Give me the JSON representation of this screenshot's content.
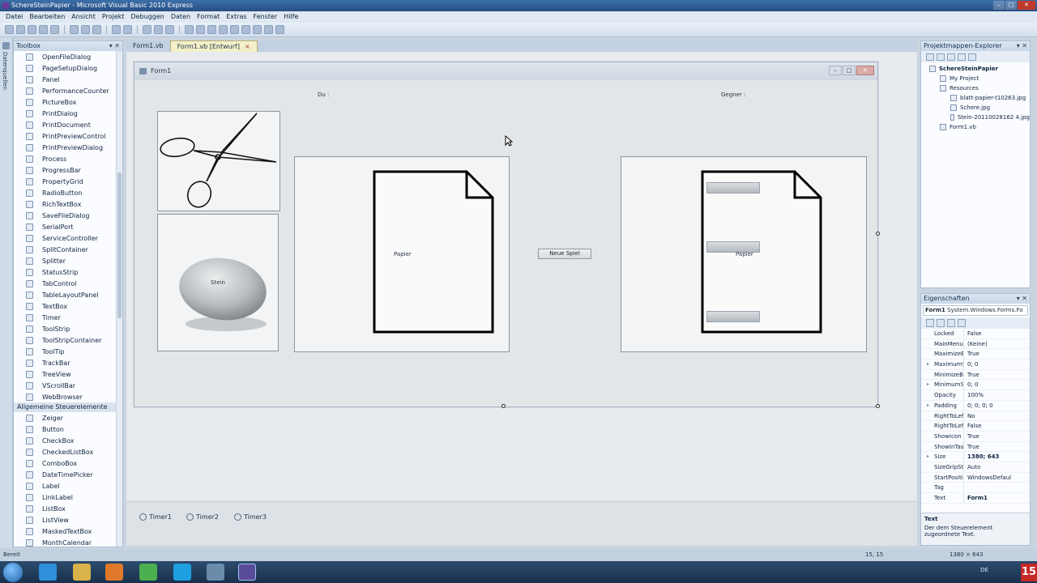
{
  "window": {
    "title": "SchereSteinPapier - Microsoft Visual Basic 2010 Express"
  },
  "menu": [
    "Datei",
    "Bearbeiten",
    "Ansicht",
    "Projekt",
    "Debuggen",
    "Daten",
    "Format",
    "Extras",
    "Fenster",
    "Hilfe"
  ],
  "left_strip": {
    "label": "Datenquellen"
  },
  "toolbox": {
    "title": "Toolbox",
    "items": [
      "OpenFileDialog",
      "PageSetupDialog",
      "Panel",
      "PerformanceCounter",
      "PictureBox",
      "PrintDialog",
      "PrintDocument",
      "PrintPreviewControl",
      "PrintPreviewDialog",
      "Process",
      "ProgressBar",
      "PropertyGrid",
      "RadioButton",
      "RichTextBox",
      "SaveFileDialog",
      "SerialPort",
      "ServiceController",
      "SplitContainer",
      "Splitter",
      "StatusStrip",
      "TabControl",
      "TableLayoutPanel",
      "TextBox",
      "Timer",
      "ToolStrip",
      "ToolStripContainer",
      "ToolTip",
      "TrackBar",
      "TreeView",
      "VScrollBar",
      "WebBrowser"
    ],
    "group_label": "Allgemeine Steuerelemente",
    "group_items": [
      "Zeiger",
      "Button",
      "CheckBox",
      "CheckedListBox",
      "ComboBox",
      "DateTimePicker",
      "Label",
      "LinkLabel",
      "ListBox",
      "ListView",
      "MaskedTextBox",
      "MonthCalendar"
    ]
  },
  "doc_tabs": [
    {
      "label": "Form1.vb",
      "active": false
    },
    {
      "label": "Form1.vb [Entwurf]",
      "active": true,
      "close": "×"
    }
  ],
  "form": {
    "title": "Form1",
    "label_you": "Du :",
    "label_opponent": "Gegner :",
    "label_stone": "Stein",
    "label_paper_left": "Papier",
    "label_paper_right": "Papier",
    "button_new_game": "Neue Spiel"
  },
  "timers": [
    "Timer1",
    "Timer2",
    "Timer3"
  ],
  "solution_explorer": {
    "title": "Projektmappen-Explorer",
    "items": [
      {
        "label": "SchereSteinPapier",
        "level": 0,
        "bold": true
      },
      {
        "label": "My Project",
        "level": 1
      },
      {
        "label": "Resources",
        "level": 1
      },
      {
        "label": "blatt-papier-t10263.jpg",
        "level": 2
      },
      {
        "label": "Schere.jpg",
        "level": 2
      },
      {
        "label": "Stein-20110028162 4.jpg",
        "level": 2
      },
      {
        "label": "Form1.vb",
        "level": 1
      }
    ]
  },
  "properties": {
    "title": "Eigenschaften",
    "object": "Form1",
    "object_type": "System.Windows.Forms.Fo",
    "rows": [
      {
        "name": "Locked",
        "value": "False"
      },
      {
        "name": "MainMenuStr",
        "value": "(Keine)"
      },
      {
        "name": "MaximizeBox",
        "value": "True"
      },
      {
        "name": "MaximumSiz",
        "value": "0; 0",
        "expand": true
      },
      {
        "name": "MinimizeBox",
        "value": "True"
      },
      {
        "name": "MinimumSiz",
        "value": "0; 0",
        "expand": true
      },
      {
        "name": "Opacity",
        "value": "100%"
      },
      {
        "name": "Padding",
        "value": "0; 0; 0; 0",
        "expand": true
      },
      {
        "name": "RightToLeft",
        "value": "No"
      },
      {
        "name": "RightToLeftL",
        "value": "False"
      },
      {
        "name": "ShowIcon",
        "value": "True"
      },
      {
        "name": "ShowInTaskb",
        "value": "True"
      },
      {
        "name": "Size",
        "value": "1380; 643",
        "expand": true,
        "bold": true
      },
      {
        "name": "SizeGripStyle",
        "value": "Auto"
      },
      {
        "name": "StartPosition",
        "value": "WindowsDefaul"
      },
      {
        "name": "Tag",
        "value": ""
      },
      {
        "name": "Text",
        "value": "Form1",
        "bold": true
      }
    ],
    "desc_title": "Text",
    "desc_text": "Der dem Steuerelement zugeordnete Text."
  },
  "status": {
    "left": "Bereit",
    "position": "15, 15",
    "size": "1380 × 643"
  },
  "taskbar": {
    "lang": "DE",
    "clock": "15"
  }
}
